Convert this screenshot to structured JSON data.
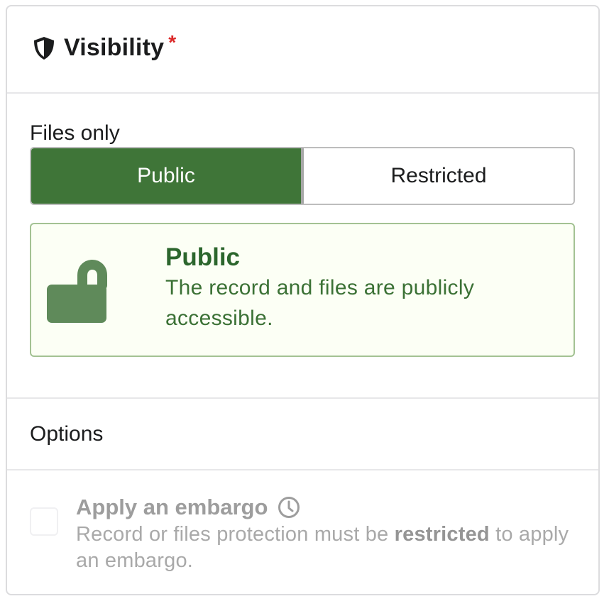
{
  "header": {
    "title": "Visibility",
    "required_marker": "*",
    "icon": "shield-icon"
  },
  "access": {
    "files_label": "Files only",
    "options": [
      {
        "label": "Public",
        "selected": true
      },
      {
        "label": "Restricted",
        "selected": false
      }
    ],
    "status": {
      "icon": "unlock-icon",
      "title": "Public",
      "description": "The record and files are publicly accessible."
    }
  },
  "options": {
    "title": "Options",
    "embargo": {
      "label": "Apply an embargo",
      "icon": "clock-icon",
      "checked": false,
      "disabled": true,
      "description_before": "Record or files protection must be ",
      "description_bold": "restricted",
      "description_after": " to apply an embargo."
    }
  },
  "colors": {
    "active_toggle": "#3f7538",
    "status_bg": "#fcfff5",
    "status_border": "#a3c293",
    "status_text": "#2c662d",
    "required": "#db2828",
    "disabled_text": "#a9a9a9"
  }
}
